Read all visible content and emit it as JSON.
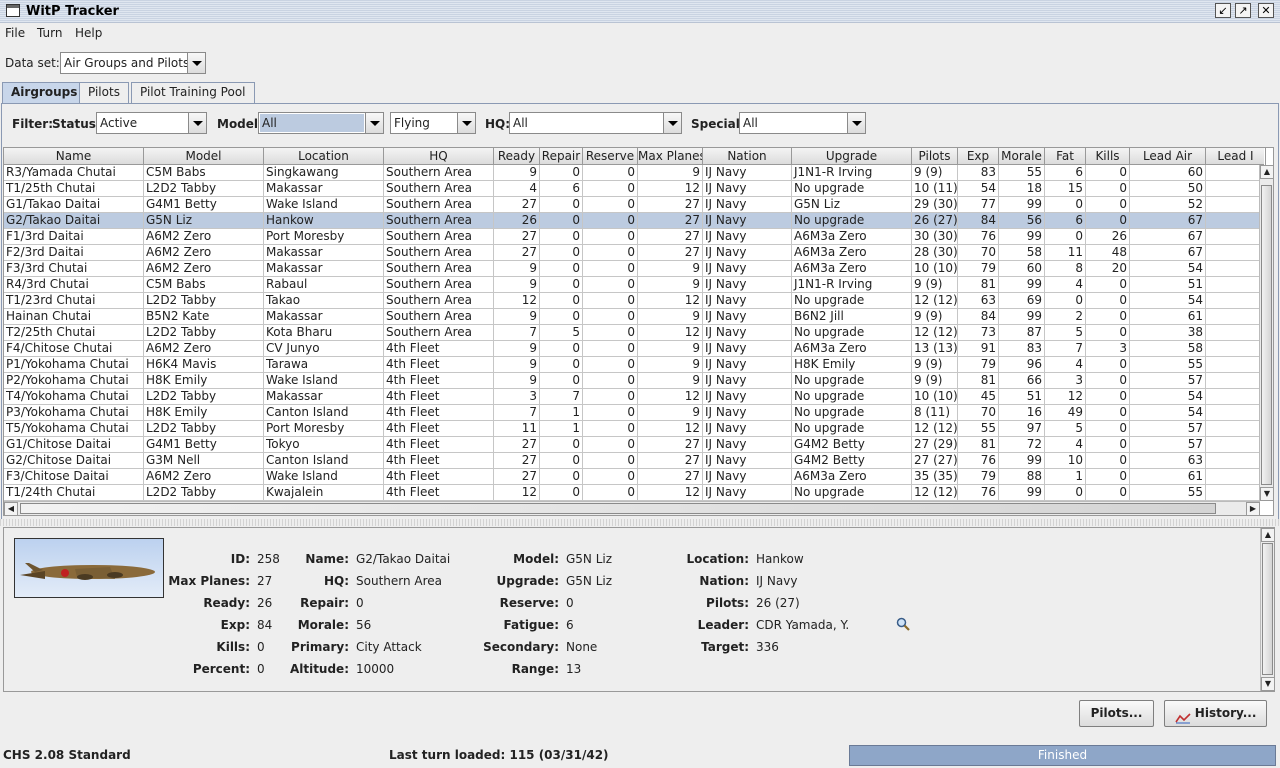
{
  "window": {
    "title": "WitP Tracker"
  },
  "menu": [
    "File",
    "Turn",
    "Help"
  ],
  "dataset": {
    "label": "Data set:",
    "value": "Air Groups and Pilots"
  },
  "tabs": [
    "Airgroups",
    "Pilots",
    "Pilot Training Pool"
  ],
  "filter": {
    "label": "Filter:",
    "status_label": "Status:",
    "status_value": "Active",
    "model_label": "Model:",
    "model_value": "All",
    "flying_value": "Flying",
    "hq_label": "HQ:",
    "hq_value": "All",
    "special_label": "Special:",
    "special_value": "All"
  },
  "table": {
    "columns": [
      "Name",
      "Model",
      "Location",
      "HQ",
      "Ready",
      "Repair",
      "Reserve",
      "Max Planes",
      "Nation",
      "Upgrade",
      "Pilots",
      "Exp",
      "Morale",
      "Fat",
      "Kills",
      "Lead Air",
      "Lead I"
    ],
    "selected_index": 3,
    "rows": [
      [
        "R3/Yamada Chutai",
        "C5M Babs",
        "Singkawang",
        "Southern Area",
        "9",
        "0",
        "0",
        "9",
        "IJ Navy",
        "J1N1-R Irving",
        "9 (9)",
        "83",
        "55",
        "6",
        "0",
        "60"
      ],
      [
        "T1/25th Chutai",
        "L2D2 Tabby",
        "Makassar",
        "Southern Area",
        "4",
        "6",
        "0",
        "12",
        "IJ Navy",
        "No upgrade",
        "10 (11)",
        "54",
        "18",
        "15",
        "0",
        "50"
      ],
      [
        "G1/Takao Daitai",
        "G4M1 Betty",
        "Wake Island",
        "Southern Area",
        "27",
        "0",
        "0",
        "27",
        "IJ Navy",
        "G5N Liz",
        "29 (30)",
        "77",
        "99",
        "0",
        "0",
        "52"
      ],
      [
        "G2/Takao Daitai",
        "G5N Liz",
        "Hankow",
        "Southern Area",
        "26",
        "0",
        "0",
        "27",
        "IJ Navy",
        "No upgrade",
        "26 (27)",
        "84",
        "56",
        "6",
        "0",
        "67"
      ],
      [
        "F1/3rd Daitai",
        "A6M2 Zero",
        "Port Moresby",
        "Southern Area",
        "27",
        "0",
        "0",
        "27",
        "IJ Navy",
        "A6M3a Zero",
        "30 (30)",
        "76",
        "99",
        "0",
        "26",
        "67"
      ],
      [
        "F2/3rd Daitai",
        "A6M2 Zero",
        "Makassar",
        "Southern Area",
        "27",
        "0",
        "0",
        "27",
        "IJ Navy",
        "A6M3a Zero",
        "28 (30)",
        "70",
        "58",
        "11",
        "48",
        "67"
      ],
      [
        "F3/3rd Chutai",
        "A6M2 Zero",
        "Makassar",
        "Southern Area",
        "9",
        "0",
        "0",
        "9",
        "IJ Navy",
        "A6M3a Zero",
        "10 (10)",
        "79",
        "60",
        "8",
        "20",
        "54"
      ],
      [
        "R4/3rd Chutai",
        "C5M Babs",
        "Rabaul",
        "Southern Area",
        "9",
        "0",
        "0",
        "9",
        "IJ Navy",
        "J1N1-R Irving",
        "9 (9)",
        "81",
        "99",
        "4",
        "0",
        "51"
      ],
      [
        "T1/23rd Chutai",
        "L2D2 Tabby",
        "Takao",
        "Southern Area",
        "12",
        "0",
        "0",
        "12",
        "IJ Navy",
        "No upgrade",
        "12 (12)",
        "63",
        "69",
        "0",
        "0",
        "54"
      ],
      [
        "Hainan Chutai",
        "B5N2 Kate",
        "Makassar",
        "Southern Area",
        "9",
        "0",
        "0",
        "9",
        "IJ Navy",
        "B6N2 Jill",
        "9 (9)",
        "84",
        "99",
        "2",
        "0",
        "61"
      ],
      [
        "T2/25th Chutai",
        "L2D2 Tabby",
        "Kota Bharu",
        "Southern Area",
        "7",
        "5",
        "0",
        "12",
        "IJ Navy",
        "No upgrade",
        "12 (12)",
        "73",
        "87",
        "5",
        "0",
        "38"
      ],
      [
        "F4/Chitose Chutai",
        "A6M2 Zero",
        "CV Junyo",
        "4th Fleet",
        "9",
        "0",
        "0",
        "9",
        "IJ Navy",
        "A6M3a Zero",
        "13 (13)",
        "91",
        "83",
        "7",
        "3",
        "58"
      ],
      [
        "P1/Yokohama Chutai",
        "H6K4 Mavis",
        "Tarawa",
        "4th Fleet",
        "9",
        "0",
        "0",
        "9",
        "IJ Navy",
        "H8K Emily",
        "9 (9)",
        "79",
        "96",
        "4",
        "0",
        "55"
      ],
      [
        "P2/Yokohama Chutai",
        "H8K Emily",
        "Wake Island",
        "4th Fleet",
        "9",
        "0",
        "0",
        "9",
        "IJ Navy",
        "No upgrade",
        "9 (9)",
        "81",
        "66",
        "3",
        "0",
        "57"
      ],
      [
        "T4/Yokohama Chutai",
        "L2D2 Tabby",
        "Makassar",
        "4th Fleet",
        "3",
        "7",
        "0",
        "12",
        "IJ Navy",
        "No upgrade",
        "10 (10)",
        "45",
        "51",
        "12",
        "0",
        "54"
      ],
      [
        "P3/Yokohama Chutai",
        "H8K Emily",
        "Canton Island",
        "4th Fleet",
        "7",
        "1",
        "0",
        "9",
        "IJ Navy",
        "No upgrade",
        "8 (11)",
        "70",
        "16",
        "49",
        "0",
        "54"
      ],
      [
        "T5/Yokohama Chutai",
        "L2D2 Tabby",
        "Port Moresby",
        "4th Fleet",
        "11",
        "1",
        "0",
        "12",
        "IJ Navy",
        "No upgrade",
        "12 (12)",
        "55",
        "97",
        "5",
        "0",
        "57"
      ],
      [
        "G1/Chitose Daitai",
        "G4M1 Betty",
        "Tokyo",
        "4th Fleet",
        "27",
        "0",
        "0",
        "27",
        "IJ Navy",
        "G4M2 Betty",
        "27 (29)",
        "81",
        "72",
        "4",
        "0",
        "57"
      ],
      [
        "G2/Chitose Daitai",
        "G3M Nell",
        "Canton Island",
        "4th Fleet",
        "27",
        "0",
        "0",
        "27",
        "IJ Navy",
        "G4M2 Betty",
        "27 (27)",
        "76",
        "99",
        "10",
        "0",
        "63"
      ],
      [
        "F3/Chitose Daitai",
        "A6M2 Zero",
        "Wake Island",
        "4th Fleet",
        "27",
        "0",
        "0",
        "27",
        "IJ Navy",
        "A6M3a Zero",
        "35 (35)",
        "79",
        "88",
        "1",
        "0",
        "61"
      ],
      [
        "T1/24th Chutai",
        "L2D2 Tabby",
        "Kwajalein",
        "4th Fleet",
        "12",
        "0",
        "0",
        "12",
        "IJ Navy",
        "No upgrade",
        "12 (12)",
        "76",
        "99",
        "0",
        "0",
        "55"
      ]
    ]
  },
  "detail": {
    "id_label": "ID:",
    "id": "258",
    "maxplanes_label": "Max Planes:",
    "maxplanes": "27",
    "ready_label": "Ready:",
    "ready": "26",
    "exp_label": "Exp:",
    "exp": "84",
    "kills_label": "Kills:",
    "kills": "0",
    "percent_label": "Percent:",
    "percent": "0",
    "name_label": "Name:",
    "name": "G2/Takao Daitai",
    "hq_label": "HQ:",
    "hq": "Southern Area",
    "repair_label": "Repair:",
    "repair": "0",
    "morale_label": "Morale:",
    "morale": "56",
    "primary_label": "Primary:",
    "primary": "City Attack",
    "altitude_label": "Altitude:",
    "altitude": "10000",
    "model_label": "Model:",
    "model": "G5N Liz",
    "upgrade_label": "Upgrade:",
    "upgrade": "G5N Liz",
    "reserve_label": "Reserve:",
    "reserve": "0",
    "fatigue_label": "Fatigue:",
    "fatigue": "6",
    "secondary_label": "Secondary:",
    "secondary": "None",
    "range_label": "Range:",
    "range": "13",
    "location_label": "Location:",
    "location": "Hankow",
    "nation_label": "Nation:",
    "nation": "IJ Navy",
    "pilots_label": "Pilots:",
    "pilots": "26 (27)",
    "leader_label": "Leader:",
    "leader": "CDR Yamada, Y.",
    "target_label": "Target:",
    "target": "336"
  },
  "buttons": {
    "pilots": "Pilots...",
    "history": "History..."
  },
  "status": {
    "version": "CHS 2.08 Standard",
    "last_turn": "Last turn loaded: 115 (03/31/42)",
    "progress_text": "Finished",
    "progress_value": 1.0
  },
  "icons": {
    "app": "window-icon",
    "magnifier": "magnifier-icon",
    "history": "chart-icon"
  }
}
